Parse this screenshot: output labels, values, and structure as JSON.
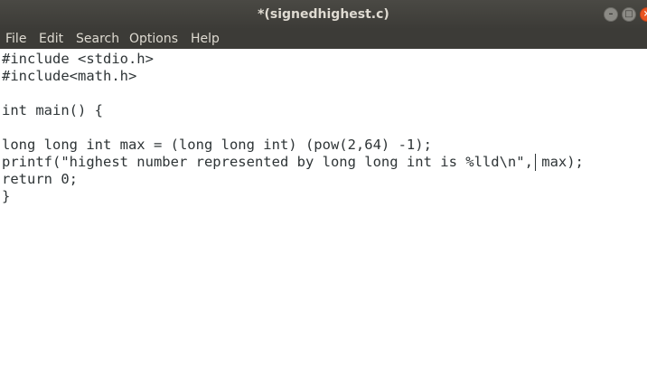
{
  "window": {
    "title": "*(signedhighest.c)",
    "controls": {
      "minimize": "–",
      "maximize": "□",
      "close": "×"
    }
  },
  "menubar": {
    "items": [
      "File",
      "Edit",
      "Search",
      "Options",
      "Help"
    ]
  },
  "editor": {
    "lines": [
      "#include <stdio.h>",
      "#include<math.h>",
      "",
      "int main() {",
      "",
      "long long int max = (long long int) (pow(2,64) -1);",
      "printf(\"highest number represented by long long int is %lld\\n\", max);",
      "return 0;",
      "}"
    ]
  },
  "colors": {
    "titlebar": "#3c3b37",
    "menubar": "#3c3b37",
    "close_button": "#e95420",
    "text": "#2e3436",
    "editor_background": "#ffffff"
  }
}
